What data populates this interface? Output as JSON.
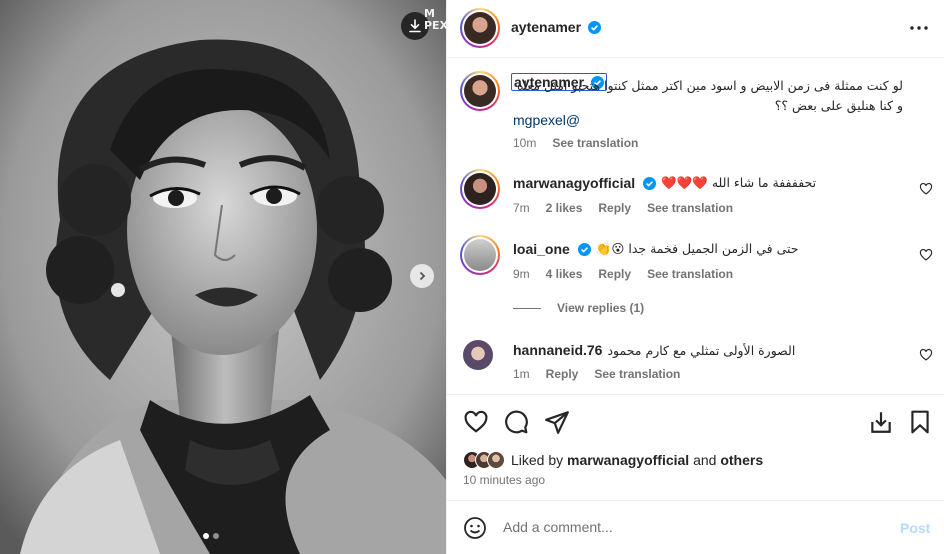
{
  "header": {
    "username": "aytenamer",
    "avatar": "avatar-aytenamer"
  },
  "caption": {
    "username": "aytenamer",
    "text": "لو كنت ممثلة فى زمن الابيض و اسود مين اكتر ممثل كنتوا هتحبو امثل معاه و كنا هنليق على بعض ؟؟",
    "mention": "mgpexel@",
    "age": "10m",
    "translate": "See translation"
  },
  "comments": [
    {
      "username": "marwanagyofficial",
      "verified": true,
      "text": "تحففففة ما شاء الله ❤️❤️❤️",
      "age": "7m",
      "likes": "2 likes",
      "reply": "Reply",
      "translate": "See translation"
    },
    {
      "username": "loai_one",
      "verified": true,
      "text": "حتى في الزمن الجميل فخمة جدا 😮👏",
      "age": "9m",
      "likes": "4 likes",
      "reply": "Reply",
      "translate": "See translation"
    },
    {
      "username": "hannaneid.76",
      "verified": false,
      "text": "الصورة الأولى تمثلي مع كارم محمود",
      "age": "1m",
      "reply": "Reply",
      "translate": "See translation"
    }
  ],
  "view_replies": "View replies (1)",
  "liked_by": {
    "prefix": "Liked by",
    "user": "marwanagyofficial",
    "and": "and",
    "others": "others"
  },
  "timestamp": "10 minutes ago",
  "add_comment": {
    "placeholder": "Add a comment...",
    "post": "Post"
  },
  "watermark": "M PEXEL",
  "carousel": {
    "slides": 2,
    "active": 1
  },
  "colors": {
    "verified": "#0095f6",
    "post_disabled": "#b3dbff",
    "link": "#00376b"
  },
  "icons": [
    "download-icon",
    "more-icon",
    "heart-icon",
    "comment-icon",
    "share-icon",
    "save-icon",
    "bookmark-icon",
    "emoji-icon",
    "chevron-right-icon"
  ]
}
